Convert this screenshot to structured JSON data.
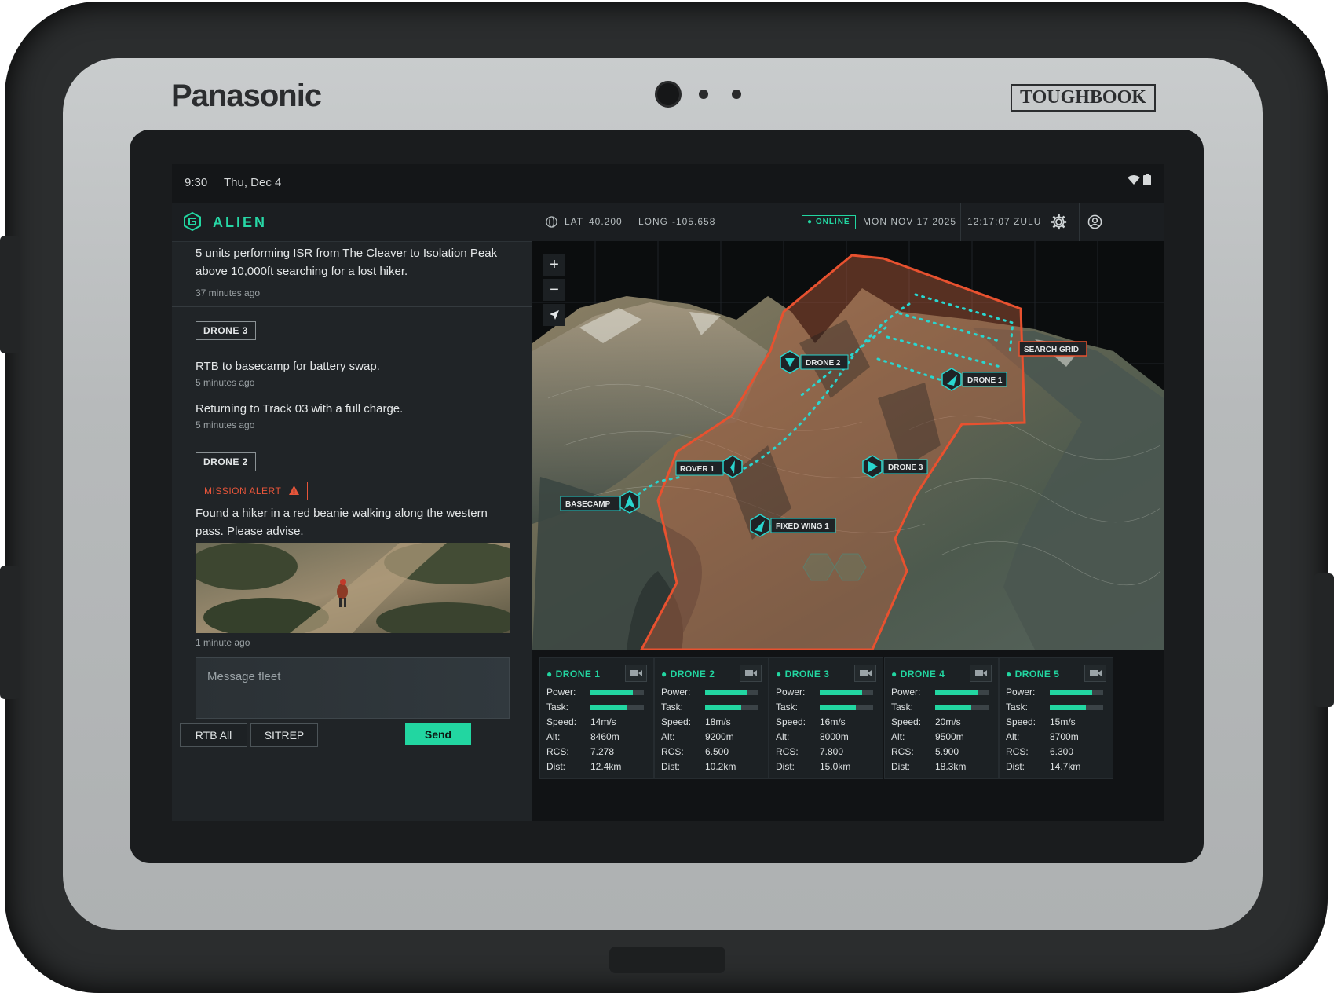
{
  "device": {
    "brand": "Panasonic",
    "model_badge": "TOUGHBOOK"
  },
  "status_bar": {
    "time": "9:30",
    "date": "Thu, Dec 4",
    "icons": [
      "wifi-icon",
      "battery-icon"
    ]
  },
  "app": {
    "name": "ALIEN",
    "accent": "#22d6a1",
    "alert_color": "#e7553a"
  },
  "top_bar": {
    "lat_label": "LAT",
    "lat_value": "40.200",
    "long_label": "LONG",
    "long_value": "-105.658",
    "status": "ONLINE",
    "date": "MON NOV 17 2025",
    "time": "12:17:07 ZULU"
  },
  "feed": {
    "intro": {
      "text": "5 units performing ISR from The Cleaver to Isolation Peak above 10,000ft searching for a lost hiker.",
      "ago": "37 minutes ago"
    },
    "drone3": {
      "tag": "DRONE 3",
      "messages": [
        {
          "text": "RTB to basecamp for battery swap.",
          "ago": "5 minutes ago"
        },
        {
          "text": "Returning to Track 03 with a full charge.",
          "ago": "5 minutes ago"
        }
      ]
    },
    "drone2": {
      "tag": "DRONE 2",
      "alert": "MISSION ALERT",
      "text": "Found a hiker in a red beanie walking along the western pass. Please advise.",
      "ago": "1 minute ago"
    }
  },
  "composer": {
    "placeholder": "Message fleet",
    "rtb_all": "RTB All",
    "sitrep": "SITREP",
    "send": "Send"
  },
  "map": {
    "zoom_in": "+",
    "zoom_out": "−",
    "locate_icon": "navigation-arrow-icon",
    "search_grid_label": "SEARCH GRID",
    "units": [
      {
        "label": "DRONE 2"
      },
      {
        "label": "DRONE 1"
      },
      {
        "label": "ROVER 1"
      },
      {
        "label": "DRONE 3"
      },
      {
        "label": "BASECAMP"
      },
      {
        "label": "FIXED WING 1"
      }
    ]
  },
  "fleet": [
    {
      "name": "DRONE 1",
      "power_label": "Power:",
      "power": 0.8,
      "task_label": "Task:",
      "task": 0.68,
      "speed_label": "Speed:",
      "speed": "14m/s",
      "alt_label": "Alt:",
      "alt": "8460m",
      "rcs_label": "RCS:",
      "rcs": "7.278",
      "dist_label": "Dist:",
      "dist": "12.4km"
    },
    {
      "name": "DRONE 2",
      "power_label": "Power:",
      "power": 0.8,
      "task_label": "Task:",
      "task": 0.68,
      "speed_label": "Speed:",
      "speed": "18m/s",
      "alt_label": "Alt:",
      "alt": "9200m",
      "rcs_label": "RCS:",
      "rcs": "6.500",
      "dist_label": "Dist:",
      "dist": "10.2km"
    },
    {
      "name": "DRONE 3",
      "power_label": "Power:",
      "power": 0.8,
      "task_label": "Task:",
      "task": 0.68,
      "speed_label": "Speed:",
      "speed": "16m/s",
      "alt_label": "Alt:",
      "alt": "8000m",
      "rcs_label": "RCS:",
      "rcs": "7.800",
      "dist_label": "Dist:",
      "dist": "15.0km"
    },
    {
      "name": "DRONE 4",
      "power_label": "Power:",
      "power": 0.8,
      "task_label": "Task:",
      "task": 0.68,
      "speed_label": "Speed:",
      "speed": "20m/s",
      "alt_label": "Alt:",
      "alt": "9500m",
      "rcs_label": "RCS:",
      "rcs": "5.900",
      "dist_label": "Dist:",
      "dist": "18.3km"
    },
    {
      "name": "DRONE 5",
      "power_label": "Power:",
      "power": 0.8,
      "task_label": "Task:",
      "task": 0.68,
      "speed_label": "Speed:",
      "speed": "15m/s",
      "alt_label": "Alt:",
      "alt": "8700m",
      "rcs_label": "RCS:",
      "rcs": "6.300",
      "dist_label": "Dist:",
      "dist": "14.7km"
    }
  ]
}
